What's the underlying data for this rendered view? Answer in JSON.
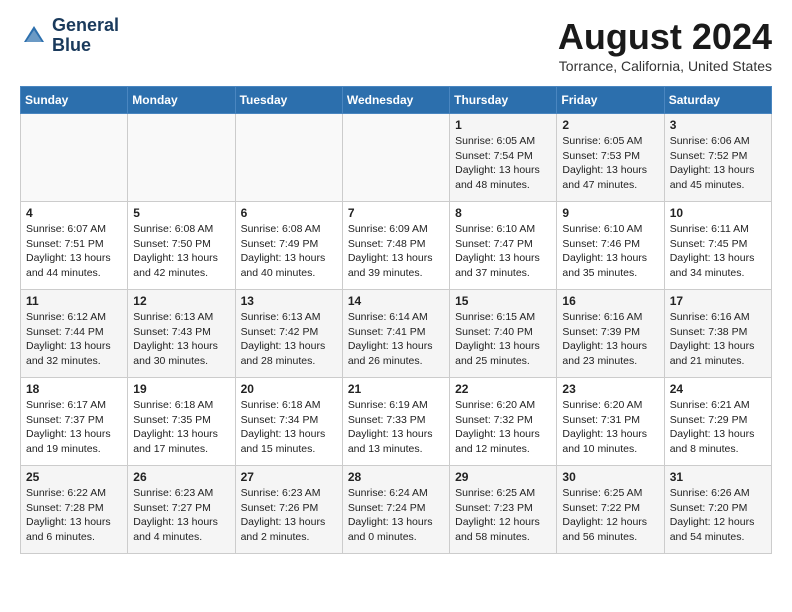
{
  "header": {
    "logo_line1": "General",
    "logo_line2": "Blue",
    "month_title": "August 2024",
    "location": "Torrance, California, United States"
  },
  "weekdays": [
    "Sunday",
    "Monday",
    "Tuesday",
    "Wednesday",
    "Thursday",
    "Friday",
    "Saturday"
  ],
  "weeks": [
    [
      {
        "day": "",
        "info": ""
      },
      {
        "day": "",
        "info": ""
      },
      {
        "day": "",
        "info": ""
      },
      {
        "day": "",
        "info": ""
      },
      {
        "day": "1",
        "info": "Sunrise: 6:05 AM\nSunset: 7:54 PM\nDaylight: 13 hours\nand 48 minutes."
      },
      {
        "day": "2",
        "info": "Sunrise: 6:05 AM\nSunset: 7:53 PM\nDaylight: 13 hours\nand 47 minutes."
      },
      {
        "day": "3",
        "info": "Sunrise: 6:06 AM\nSunset: 7:52 PM\nDaylight: 13 hours\nand 45 minutes."
      }
    ],
    [
      {
        "day": "4",
        "info": "Sunrise: 6:07 AM\nSunset: 7:51 PM\nDaylight: 13 hours\nand 44 minutes."
      },
      {
        "day": "5",
        "info": "Sunrise: 6:08 AM\nSunset: 7:50 PM\nDaylight: 13 hours\nand 42 minutes."
      },
      {
        "day": "6",
        "info": "Sunrise: 6:08 AM\nSunset: 7:49 PM\nDaylight: 13 hours\nand 40 minutes."
      },
      {
        "day": "7",
        "info": "Sunrise: 6:09 AM\nSunset: 7:48 PM\nDaylight: 13 hours\nand 39 minutes."
      },
      {
        "day": "8",
        "info": "Sunrise: 6:10 AM\nSunset: 7:47 PM\nDaylight: 13 hours\nand 37 minutes."
      },
      {
        "day": "9",
        "info": "Sunrise: 6:10 AM\nSunset: 7:46 PM\nDaylight: 13 hours\nand 35 minutes."
      },
      {
        "day": "10",
        "info": "Sunrise: 6:11 AM\nSunset: 7:45 PM\nDaylight: 13 hours\nand 34 minutes."
      }
    ],
    [
      {
        "day": "11",
        "info": "Sunrise: 6:12 AM\nSunset: 7:44 PM\nDaylight: 13 hours\nand 32 minutes."
      },
      {
        "day": "12",
        "info": "Sunrise: 6:13 AM\nSunset: 7:43 PM\nDaylight: 13 hours\nand 30 minutes."
      },
      {
        "day": "13",
        "info": "Sunrise: 6:13 AM\nSunset: 7:42 PM\nDaylight: 13 hours\nand 28 minutes."
      },
      {
        "day": "14",
        "info": "Sunrise: 6:14 AM\nSunset: 7:41 PM\nDaylight: 13 hours\nand 26 minutes."
      },
      {
        "day": "15",
        "info": "Sunrise: 6:15 AM\nSunset: 7:40 PM\nDaylight: 13 hours\nand 25 minutes."
      },
      {
        "day": "16",
        "info": "Sunrise: 6:16 AM\nSunset: 7:39 PM\nDaylight: 13 hours\nand 23 minutes."
      },
      {
        "day": "17",
        "info": "Sunrise: 6:16 AM\nSunset: 7:38 PM\nDaylight: 13 hours\nand 21 minutes."
      }
    ],
    [
      {
        "day": "18",
        "info": "Sunrise: 6:17 AM\nSunset: 7:37 PM\nDaylight: 13 hours\nand 19 minutes."
      },
      {
        "day": "19",
        "info": "Sunrise: 6:18 AM\nSunset: 7:35 PM\nDaylight: 13 hours\nand 17 minutes."
      },
      {
        "day": "20",
        "info": "Sunrise: 6:18 AM\nSunset: 7:34 PM\nDaylight: 13 hours\nand 15 minutes."
      },
      {
        "day": "21",
        "info": "Sunrise: 6:19 AM\nSunset: 7:33 PM\nDaylight: 13 hours\nand 13 minutes."
      },
      {
        "day": "22",
        "info": "Sunrise: 6:20 AM\nSunset: 7:32 PM\nDaylight: 13 hours\nand 12 minutes."
      },
      {
        "day": "23",
        "info": "Sunrise: 6:20 AM\nSunset: 7:31 PM\nDaylight: 13 hours\nand 10 minutes."
      },
      {
        "day": "24",
        "info": "Sunrise: 6:21 AM\nSunset: 7:29 PM\nDaylight: 13 hours\nand 8 minutes."
      }
    ],
    [
      {
        "day": "25",
        "info": "Sunrise: 6:22 AM\nSunset: 7:28 PM\nDaylight: 13 hours\nand 6 minutes."
      },
      {
        "day": "26",
        "info": "Sunrise: 6:23 AM\nSunset: 7:27 PM\nDaylight: 13 hours\nand 4 minutes."
      },
      {
        "day": "27",
        "info": "Sunrise: 6:23 AM\nSunset: 7:26 PM\nDaylight: 13 hours\nand 2 minutes."
      },
      {
        "day": "28",
        "info": "Sunrise: 6:24 AM\nSunset: 7:24 PM\nDaylight: 13 hours\nand 0 minutes."
      },
      {
        "day": "29",
        "info": "Sunrise: 6:25 AM\nSunset: 7:23 PM\nDaylight: 12 hours\nand 58 minutes."
      },
      {
        "day": "30",
        "info": "Sunrise: 6:25 AM\nSunset: 7:22 PM\nDaylight: 12 hours\nand 56 minutes."
      },
      {
        "day": "31",
        "info": "Sunrise: 6:26 AM\nSunset: 7:20 PM\nDaylight: 12 hours\nand 54 minutes."
      }
    ]
  ]
}
